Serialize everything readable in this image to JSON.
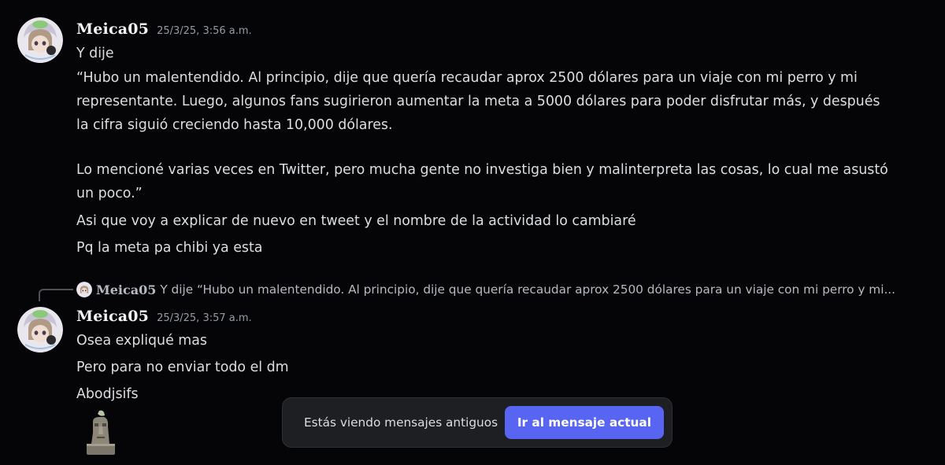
{
  "messages": [
    {
      "username": "Meica05",
      "timestamp": "25/3/25, 3:56 a.m.",
      "lines": [
        "Y dije",
        "“Hubo un malentendido. Al principio, dije que quería recaudar aprox 2500 dólares para un viaje con mi perro y mi",
        "representante. Luego, algunos fans sugirieron aumentar la meta a 5000 dólares para poder disfrutar más, y después",
        "la cifra siguió creciendo hasta 10,000 dólares.",
        "",
        "Lo mencioné varias veces en Twitter, pero mucha gente no investiga bien y malinterpreta las cosas, lo cual me asustó",
        "un poco.”",
        "Asi que voy a explicar de nuevo en tweet y el nombre de la actividad lo cambiaré",
        "Pq la meta pa chibi ya esta"
      ]
    },
    {
      "reply_to": {
        "username": "Meica05",
        "preview": "Y dije “Hubo un malentendido. Al principio, dije que quería recaudar aprox 2500 dólares para un viaje con mi perro y mi..."
      },
      "username": "Meica05",
      "timestamp": "25/3/25, 3:57 a.m.",
      "lines": [
        "Osea expliqué mas",
        "Pero para no enviar todo el dm",
        "Abodjsifs"
      ],
      "sticker_icon": "moai-statue-sticker"
    }
  ],
  "banner": {
    "text": "Estás viendo mensajes antiguos",
    "button_label": "Ir al mensaje actual"
  },
  "colors": {
    "background": "#050507",
    "accent": "#5865f2",
    "timestamp": "#949ba4"
  }
}
